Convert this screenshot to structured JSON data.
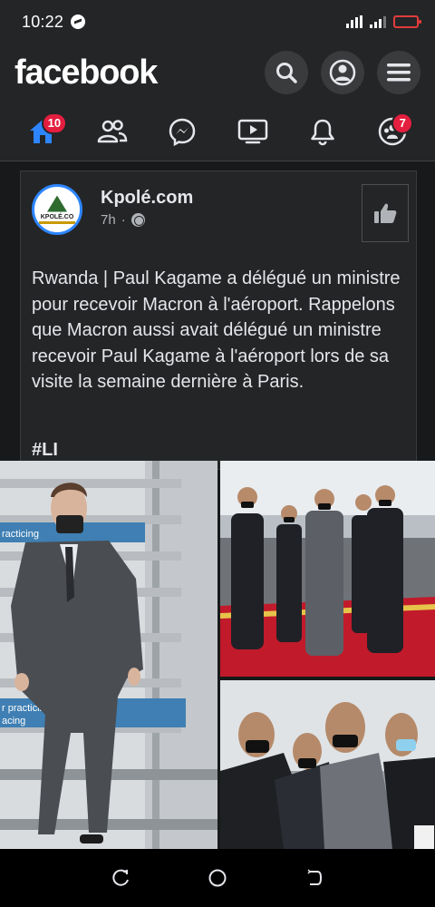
{
  "status_bar": {
    "time": "10:22"
  },
  "header": {
    "logo": "facebook"
  },
  "nav": {
    "items": [
      {
        "icon": "home-icon",
        "badge": "10",
        "active": true
      },
      {
        "icon": "friends-icon",
        "badge": ""
      },
      {
        "icon": "messenger-icon",
        "badge": ""
      },
      {
        "icon": "watch-icon",
        "badge": ""
      },
      {
        "icon": "bell-icon",
        "badge": ""
      },
      {
        "icon": "groups-icon",
        "badge": "7"
      }
    ]
  },
  "post": {
    "page_name": "Kpolé.com",
    "avatar_text": "KPOLÉ.CO",
    "time": "7h",
    "separator": "·",
    "text": "Rwanda | Paul Kagame a délégué un ministre pour recevoir Macron à l'aéroport. Rappelons que Macron aussi avait délégué un ministre recevoir Paul Kagame à l'aéroport lors de sa visite la semaine dernière à Paris.",
    "hashtag": "#LI"
  },
  "photos": {
    "photo1_caption_a": "racticing",
    "photo1_caption_b": "r practicing,",
    "photo1_caption_c": "acing"
  },
  "colors": {
    "accent": "#2d86ff",
    "badge": "#e41e3f",
    "surface": "#242526",
    "background": "#18191a"
  }
}
